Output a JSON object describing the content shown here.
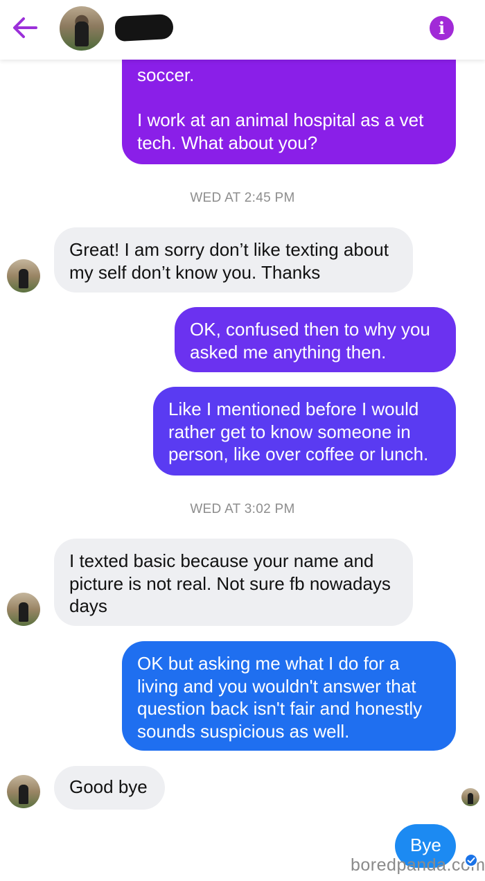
{
  "header": {
    "back_icon": "arrow-left-icon",
    "info_icon": "info-icon",
    "info_glyph": "i",
    "accent": "#9b30d9"
  },
  "messages": [
    {
      "id": "m1",
      "type": "sent",
      "text": "soccer.\n\nI work at an animal hospital as a vet tech. What about you?",
      "color": "#8a1fe8"
    },
    {
      "id": "t1",
      "type": "timestamp",
      "text": "WED AT 2:45 PM"
    },
    {
      "id": "m2",
      "type": "received",
      "text": "Great! I am sorry don’t like texting about my self don’t know you. Thanks"
    },
    {
      "id": "m3",
      "type": "sent",
      "text": "OK, confused then to why you asked me anything then.",
      "color": "#6b32f0"
    },
    {
      "id": "m4",
      "type": "sent",
      "text": "Like I mentioned before I would rather get to know someone in person, like over coffee or lunch.",
      "color": "#5a3bf2"
    },
    {
      "id": "t2",
      "type": "timestamp",
      "text": "WED AT 3:02 PM"
    },
    {
      "id": "m5",
      "type": "received",
      "text": "I texted basic because your name and picture is not real.  Not sure fb nowadays days"
    },
    {
      "id": "m6",
      "type": "sent",
      "text": "OK but asking me what I do for a living and you wouldn't answer that question back isn't fair and honestly sounds suspicious as well.",
      "color": "#1f6ff0"
    },
    {
      "id": "m7",
      "type": "received",
      "text": "Good bye"
    },
    {
      "id": "m8",
      "type": "sent",
      "text": "Bye",
      "color": "#1c8af2"
    }
  ],
  "watermark": "boredpanda.com"
}
